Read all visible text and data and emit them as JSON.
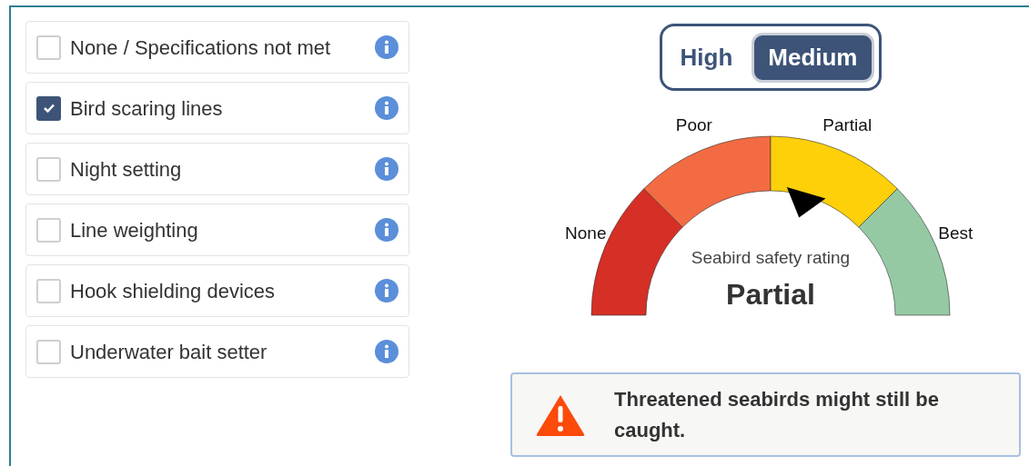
{
  "options": [
    {
      "label": "None / Specifications not met",
      "checked": false
    },
    {
      "label": "Bird scaring lines",
      "checked": true
    },
    {
      "label": "Night setting",
      "checked": false
    },
    {
      "label": "Line weighting",
      "checked": false
    },
    {
      "label": "Hook shielding devices",
      "checked": false
    },
    {
      "label": "Underwater bait setter",
      "checked": false
    }
  ],
  "toggle": [
    {
      "label": "High",
      "selected": false
    },
    {
      "label": "Medium",
      "selected": true
    }
  ],
  "gauge": {
    "title": "Seabird safety rating",
    "value": "Partial",
    "level": 0.59,
    "segments": [
      {
        "label": "None",
        "color": "#d62f26"
      },
      {
        "label": "Poor",
        "color": "#f26b43"
      },
      {
        "label": "Partial",
        "color": "#fdd009"
      },
      {
        "label": "Best",
        "color": "#95c9a4"
      }
    ]
  },
  "alert": {
    "text": "Threatened seabirds might still be caught."
  }
}
